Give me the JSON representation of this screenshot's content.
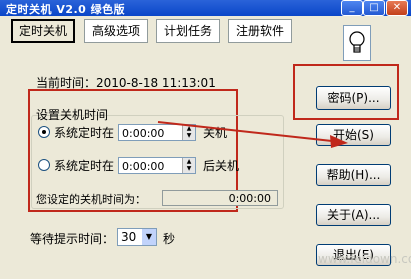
{
  "window": {
    "title": "定时关机 V2.0 绿色版",
    "minimize_icon": "minimize-icon",
    "maximize_icon": "maximize-icon",
    "close_icon": "close-icon"
  },
  "tabs": [
    {
      "label": "定时关机",
      "active": true
    },
    {
      "label": "高级选项",
      "active": false
    },
    {
      "label": "计划任务",
      "active": false
    },
    {
      "label": "注册软件",
      "active": false
    }
  ],
  "current_time": {
    "label": "当前时间：",
    "value": "2010-8-18 11:13:01"
  },
  "shutdown_group": {
    "title": "设置关机时间",
    "option1": {
      "prefix": "系统定时在",
      "time": "0:00:00",
      "suffix": "关机",
      "selected": true
    },
    "option2": {
      "prefix": "系统定时在",
      "time": "0:00:00",
      "suffix": "后关机",
      "selected": false
    },
    "result_label": "您设定的关机时间为：",
    "result_value": "0:00:00"
  },
  "wait_prompt": {
    "label": "等待提示时间：",
    "value": "30",
    "unit": "秒"
  },
  "buttons": {
    "password": "密码(P)...",
    "start": "开始(S)",
    "help": "帮助(H)...",
    "about": "关于(A)...",
    "exit": "退出(E)"
  },
  "icons": {
    "bulb": "lightbulb-icon",
    "arrow": "arrow-annotation-icon"
  },
  "colors": {
    "titlebar": "#0a46c8",
    "annotation": "#c0281b",
    "background": "#ece9d8"
  }
}
